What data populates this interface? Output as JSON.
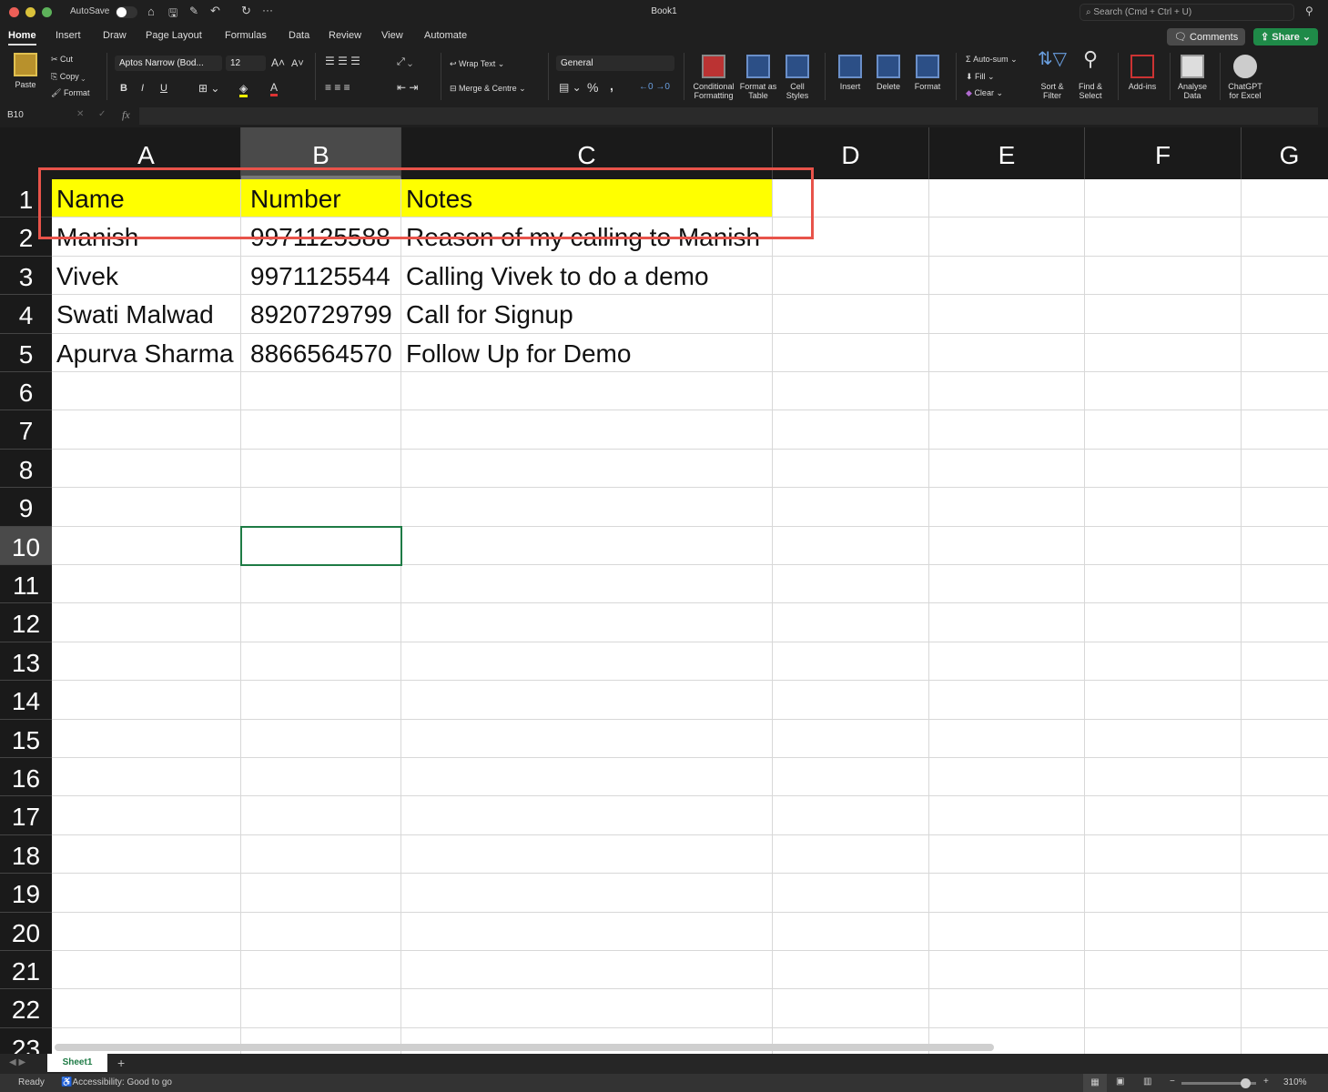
{
  "titlebar": {
    "autosave": "AutoSave",
    "title": "Book1",
    "search_placeholder": "Search (Cmd + Ctrl + U)"
  },
  "tabs": [
    "Home",
    "Insert",
    "Draw",
    "Page Layout",
    "Formulas",
    "Data",
    "Review",
    "View",
    "Automate"
  ],
  "top_buttons": {
    "comments": "Comments",
    "share": "Share"
  },
  "ribbon": {
    "paste": "Paste",
    "cut": "Cut",
    "copy": "Copy",
    "format_painter": "Format",
    "font_name": "Aptos Narrow (Bod...",
    "font_size": "12",
    "bold": "B",
    "italic": "I",
    "underline": "U",
    "wrap_text": "Wrap Text",
    "merge": "Merge & Centre",
    "number_format": "General",
    "percent": "%",
    "comma": ",",
    "cond_format": "Conditional Formatting",
    "format_table": "Format as Table",
    "cell_styles": "Cell Styles",
    "insert": "Insert",
    "delete": "Delete",
    "format": "Format",
    "autosum": "Auto-sum",
    "fill": "Fill",
    "clear": "Clear",
    "sort_filter": "Sort & Filter",
    "find_select": "Find & Select",
    "addins": "Add-ins",
    "analyse": "Analyse Data",
    "chatgpt": "ChatGPT for Excel"
  },
  "formula_bar": {
    "name_box": "B10",
    "fx": "fx",
    "value": ""
  },
  "columns": [
    "A",
    "B",
    "C",
    "D",
    "E",
    "F",
    "G"
  ],
  "row_labels": [
    "1",
    "2",
    "3",
    "4",
    "5",
    "6",
    "7",
    "8",
    "9",
    "10",
    "11",
    "12",
    "13",
    "14",
    "15",
    "16",
    "17",
    "18",
    "19",
    "20",
    "21",
    "22",
    "23"
  ],
  "cells": [
    [
      "Name",
      "Number",
      "Notes"
    ],
    [
      "Manish",
      "9971125588",
      "Reason of my calling to Manish"
    ],
    [
      "Vivek",
      "9971125544",
      "Calling Vivek to do a demo"
    ],
    [
      "Swati Malwad",
      "8920729799",
      "Call for Signup"
    ],
    [
      "Apurva Sharma",
      "8866564570",
      "Follow Up for Demo"
    ]
  ],
  "selected_cell": "B10",
  "header_fill": "#ffff00",
  "sheets": [
    "Sheet1"
  ],
  "status": {
    "ready": "Ready",
    "accessibility": "Accessibility: Good to go",
    "zoom": "310%",
    "zoom_fraction": 0.85
  }
}
